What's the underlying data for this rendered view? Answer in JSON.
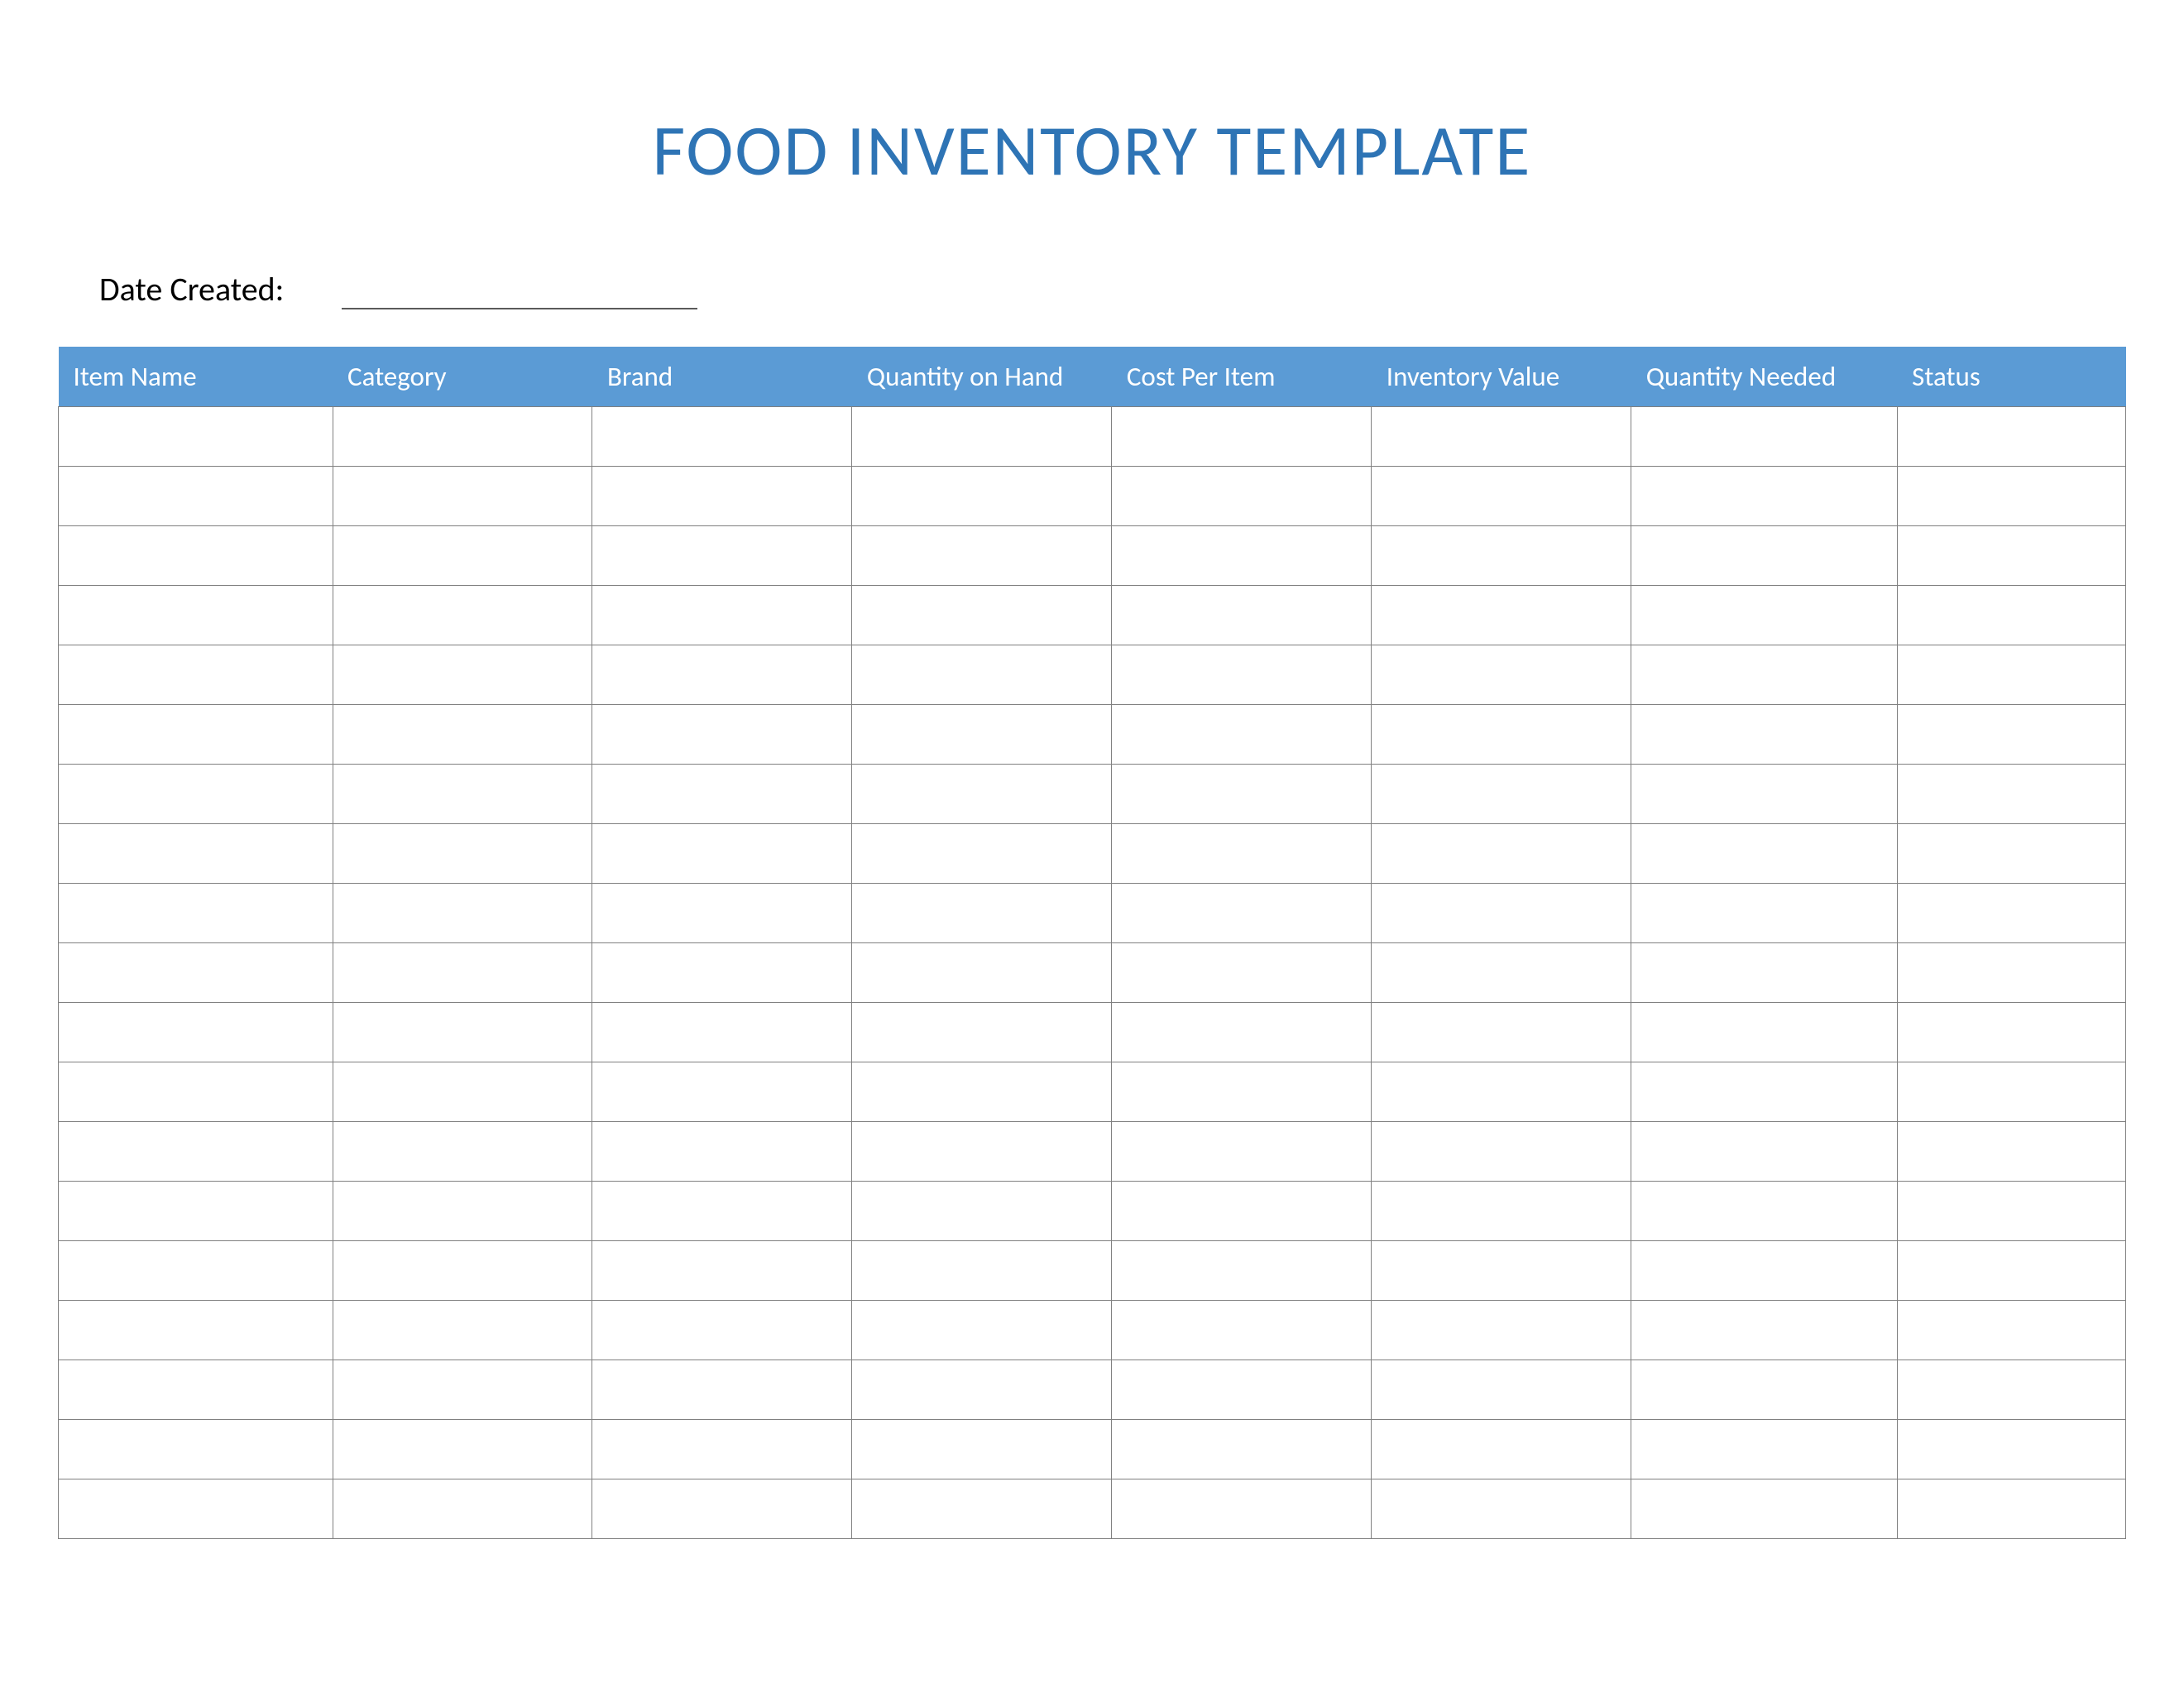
{
  "title": "FOOD INVENTORY TEMPLATE",
  "dateCreatedLabel": "Date Created:",
  "dateCreatedValue": "",
  "table": {
    "headers": {
      "itemName": "Item Name",
      "category": "Category",
      "brand": "Brand",
      "quantityOnHand": "Quantity on Hand",
      "costPerItem": "Cost Per Item",
      "inventoryValue": "Inventory Value",
      "quantityNeeded": "Quantity Needed",
      "status": "Status"
    },
    "rows": [
      {
        "itemName": "",
        "category": "",
        "brand": "",
        "quantityOnHand": "",
        "costPerItem": "",
        "inventoryValue": "",
        "quantityNeeded": "",
        "status": ""
      },
      {
        "itemName": "",
        "category": "",
        "brand": "",
        "quantityOnHand": "",
        "costPerItem": "",
        "inventoryValue": "",
        "quantityNeeded": "",
        "status": ""
      },
      {
        "itemName": "",
        "category": "",
        "brand": "",
        "quantityOnHand": "",
        "costPerItem": "",
        "inventoryValue": "",
        "quantityNeeded": "",
        "status": ""
      },
      {
        "itemName": "",
        "category": "",
        "brand": "",
        "quantityOnHand": "",
        "costPerItem": "",
        "inventoryValue": "",
        "quantityNeeded": "",
        "status": ""
      },
      {
        "itemName": "",
        "category": "",
        "brand": "",
        "quantityOnHand": "",
        "costPerItem": "",
        "inventoryValue": "",
        "quantityNeeded": "",
        "status": ""
      },
      {
        "itemName": "",
        "category": "",
        "brand": "",
        "quantityOnHand": "",
        "costPerItem": "",
        "inventoryValue": "",
        "quantityNeeded": "",
        "status": ""
      },
      {
        "itemName": "",
        "category": "",
        "brand": "",
        "quantityOnHand": "",
        "costPerItem": "",
        "inventoryValue": "",
        "quantityNeeded": "",
        "status": ""
      },
      {
        "itemName": "",
        "category": "",
        "brand": "",
        "quantityOnHand": "",
        "costPerItem": "",
        "inventoryValue": "",
        "quantityNeeded": "",
        "status": ""
      },
      {
        "itemName": "",
        "category": "",
        "brand": "",
        "quantityOnHand": "",
        "costPerItem": "",
        "inventoryValue": "",
        "quantityNeeded": "",
        "status": ""
      },
      {
        "itemName": "",
        "category": "",
        "brand": "",
        "quantityOnHand": "",
        "costPerItem": "",
        "inventoryValue": "",
        "quantityNeeded": "",
        "status": ""
      },
      {
        "itemName": "",
        "category": "",
        "brand": "",
        "quantityOnHand": "",
        "costPerItem": "",
        "inventoryValue": "",
        "quantityNeeded": "",
        "status": ""
      },
      {
        "itemName": "",
        "category": "",
        "brand": "",
        "quantityOnHand": "",
        "costPerItem": "",
        "inventoryValue": "",
        "quantityNeeded": "",
        "status": ""
      },
      {
        "itemName": "",
        "category": "",
        "brand": "",
        "quantityOnHand": "",
        "costPerItem": "",
        "inventoryValue": "",
        "quantityNeeded": "",
        "status": ""
      },
      {
        "itemName": "",
        "category": "",
        "brand": "",
        "quantityOnHand": "",
        "costPerItem": "",
        "inventoryValue": "",
        "quantityNeeded": "",
        "status": ""
      },
      {
        "itemName": "",
        "category": "",
        "brand": "",
        "quantityOnHand": "",
        "costPerItem": "",
        "inventoryValue": "",
        "quantityNeeded": "",
        "status": ""
      },
      {
        "itemName": "",
        "category": "",
        "brand": "",
        "quantityOnHand": "",
        "costPerItem": "",
        "inventoryValue": "",
        "quantityNeeded": "",
        "status": ""
      },
      {
        "itemName": "",
        "category": "",
        "brand": "",
        "quantityOnHand": "",
        "costPerItem": "",
        "inventoryValue": "",
        "quantityNeeded": "",
        "status": ""
      },
      {
        "itemName": "",
        "category": "",
        "brand": "",
        "quantityOnHand": "",
        "costPerItem": "",
        "inventoryValue": "",
        "quantityNeeded": "",
        "status": ""
      },
      {
        "itemName": "",
        "category": "",
        "brand": "",
        "quantityOnHand": "",
        "costPerItem": "",
        "inventoryValue": "",
        "quantityNeeded": "",
        "status": ""
      }
    ]
  },
  "colors": {
    "titleColor": "#2e74b5",
    "headerBg": "#5b9bd5",
    "headerText": "#ffffff",
    "cellBorder": "#808080"
  }
}
